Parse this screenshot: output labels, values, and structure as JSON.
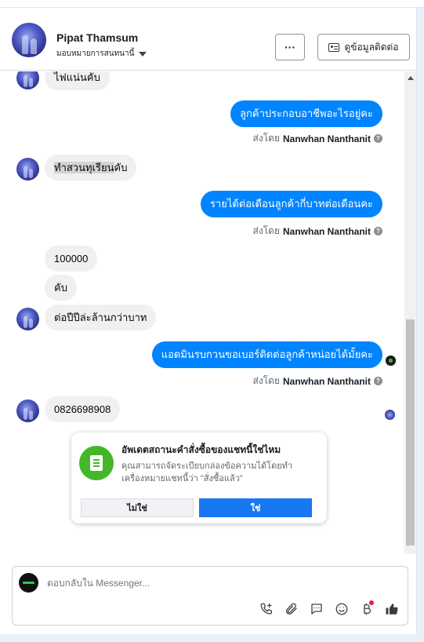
{
  "header": {
    "name": "Pipat Thamsum",
    "assignee": "มอบหมายการสนทนานี้",
    "more_label": "···",
    "contact_label": "ดูข้อมูลติดต่อ"
  },
  "messages": {
    "m1": "ไฟแน่นคับ",
    "m2": "ลูกค้าประกอบอาชีพอะไรอยู่คะ",
    "m3a": "ทำสวนทุเรียน",
    "m3b": "คับ",
    "m4": "รายได้ต่อเดือนลูกค้ากี่บาทต่อเดือนคะ",
    "m5": "100000",
    "m6": "คับ",
    "m7": "ต่อปีปีล่ะล้านกว่าบาท",
    "m8": "แอดมินรบกวนขอเบอร์ติดต่อลูกค้าหน่อยได้มั้ยคะ",
    "m9": "0826698908"
  },
  "sent_by": {
    "prefix": "ส่งโดย",
    "agent": "Nanwhan Nanthanit",
    "help": "?"
  },
  "order_card": {
    "title": "อัพเดตสถานะคำสั่งซื้อของแชทนี้ใช่ไหม",
    "text": "คุณสามารถจัดระเบียบกล่องข้อความได้โดยทำเครื่องหมายแชทนี้ว่า \"สั่งซื้อแล้ว\"",
    "no_label": "ไม่ใช่",
    "yes_label": "ใช่"
  },
  "composer": {
    "placeholder": "ตอบกลับใน Messenger..."
  },
  "icons": [
    "phone-plus-icon",
    "paperclip-icon",
    "chat-bubble-icon",
    "emoji-icon",
    "baht-icon",
    "thumbs-up-icon"
  ],
  "colors": {
    "outgoing_bubble": "#0084ff",
    "incoming_bubble": "#f0f0f0",
    "primary_button": "#1877f2",
    "card_icon": "#42b72a"
  }
}
